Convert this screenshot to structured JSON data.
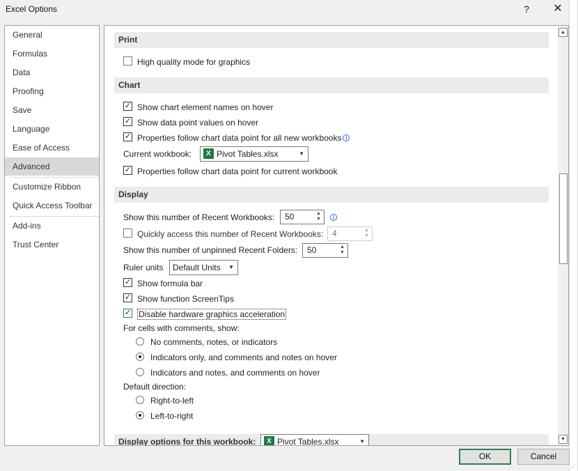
{
  "window": {
    "title": "Excel Options",
    "help": "?",
    "close": "✕"
  },
  "sidebar": {
    "items": [
      {
        "label": "General"
      },
      {
        "label": "Formulas"
      },
      {
        "label": "Data"
      },
      {
        "label": "Proofing"
      },
      {
        "label": "Save"
      },
      {
        "label": "Language"
      },
      {
        "label": "Ease of Access"
      },
      {
        "label": "Advanced"
      },
      {
        "label": "Customize Ribbon"
      },
      {
        "label": "Quick Access Toolbar"
      },
      {
        "label": "Add-ins"
      },
      {
        "label": "Trust Center"
      }
    ],
    "active": "Advanced"
  },
  "print": {
    "header": "Print",
    "high_quality": "High quality mode for graphics"
  },
  "chart": {
    "header": "Chart",
    "show_names": "Show chart element names on hover",
    "show_values": "Show data point values on hover",
    "props_all": "Properties follow chart data point for all new workbooks",
    "current_workbook_label": "Current workbook:",
    "current_workbook_value": "Pivot Tables.xlsx",
    "props_current": "Properties follow chart data point for current workbook"
  },
  "display": {
    "header": "Display",
    "recent_workbooks_label": "Show this number of Recent Workbooks:",
    "recent_workbooks_value": "50",
    "quick_access_label": "Quickly access this number of Recent Workbooks:",
    "quick_access_value": "4",
    "unpinned_folders_label": "Show this number of unpinned Recent Folders:",
    "unpinned_folders_value": "50",
    "ruler_units_label": "Ruler units",
    "ruler_units_value": "Default Units",
    "formula_bar": "Show formula bar",
    "screentips": "Show function ScreenTips",
    "hw_accel": "Disable hardware graphics acceleration",
    "comments_label": "For cells with comments, show:",
    "comments_none": "No comments, notes, or indicators",
    "comments_indicators": "Indicators only, and comments and notes on hover",
    "comments_both": "Indicators and notes, and comments on hover",
    "direction_label": "Default direction:",
    "rtl": "Right-to-left",
    "ltr": "Left-to-right"
  },
  "display_workbook": {
    "header": "Display options for this workbook:",
    "value": "Pivot Tables.xlsx"
  },
  "buttons": {
    "ok": "OK",
    "cancel": "Cancel"
  },
  "icons": {
    "info": "info-icon",
    "excel": "excel-file-icon",
    "dropdown": "chevron-down-icon"
  }
}
